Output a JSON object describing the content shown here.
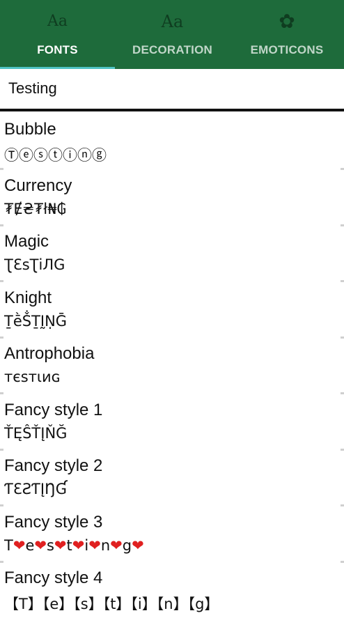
{
  "tabs": [
    {
      "label": "FONTS",
      "icon": "font-style-icon",
      "glyph": "Aa",
      "active": true
    },
    {
      "label": "DECORATION",
      "icon": "decoration-icon",
      "glyph": "Aa",
      "active": false
    },
    {
      "label": "EMOTICONS",
      "icon": "emoticon-icon",
      "glyph": "✿",
      "active": false
    }
  ],
  "input": {
    "value": "Testing"
  },
  "styles": [
    {
      "name": "Bubble",
      "sample": "Ⓣⓔⓢⓣⓘⓝⓖ"
    },
    {
      "name": "Currency",
      "sample": "₮Ɇ₴₮ł₦₲"
    },
    {
      "name": "Magic",
      "sample": "ƮƐsƮiЛG"
    },
    {
      "name": "Knight",
      "sample": "ṮḕṦṮḬṆḠ"
    },
    {
      "name": "Antrophobia",
      "sample": "ᴛєѕᴛιиɢ"
    },
    {
      "name": "Fancy style 1",
      "sample": "ŤĘŜŤĮŇĞ"
    },
    {
      "name": "Fancy style 2",
      "sample": "ƬƐƧƬĮŊƓ"
    },
    {
      "name": "Fancy style 3",
      "sample": "T❤e❤s❤t❤i❤n❤g❤"
    },
    {
      "name": "Fancy style 4",
      "sample": "【T】【e】【s】【t】【i】【n】【g】"
    }
  ],
  "colors": {
    "header": "#1e6b3b",
    "indicator": "#4fc3c4",
    "heart": "#e02020"
  }
}
